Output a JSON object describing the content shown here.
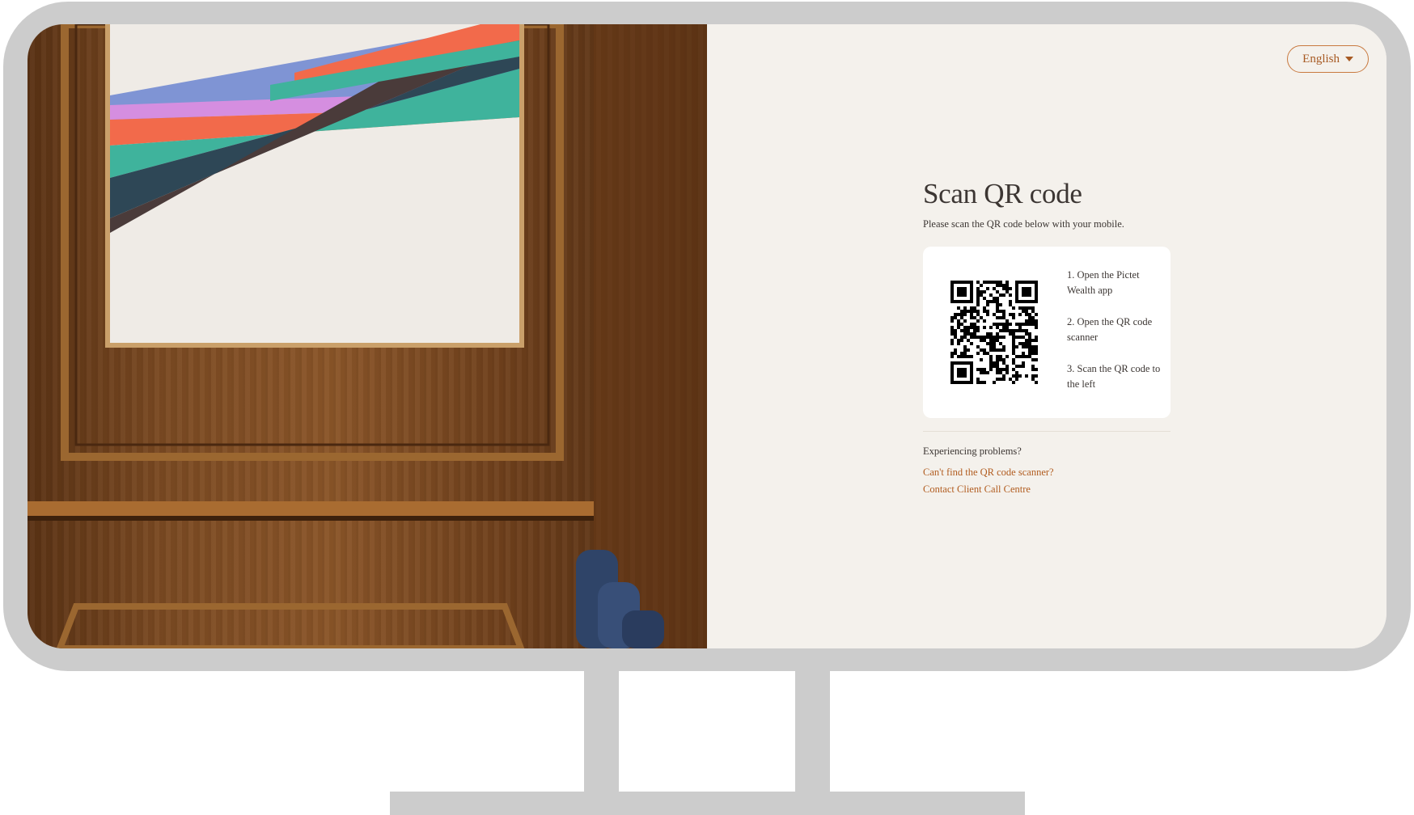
{
  "header": {
    "language_label": "English"
  },
  "main": {
    "title": "Scan QR code",
    "subtitle": "Please scan the QR code below with your mobile.",
    "steps": [
      "1. Open the Pictet Wealth app",
      "2. Open the QR code scanner",
      "3. Scan the QR code to the left"
    ],
    "problems_label": "Experiencing problems?",
    "links": {
      "scanner_help": "Can't find the QR code scanner?",
      "contact": "Contact Client Call Centre"
    }
  },
  "colors": {
    "accent": "#b15c1f",
    "background": "#f4f1ec",
    "text": "#3c3633",
    "monitor_frame": "#cccccc"
  },
  "icons": {
    "language_caret": "caret-down-icon",
    "qr": "qr-code-icon"
  }
}
